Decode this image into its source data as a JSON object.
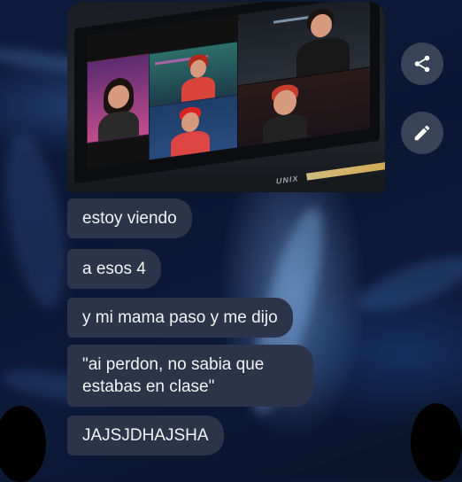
{
  "messages": [
    {
      "text": "estoy viendo"
    },
    {
      "text": "a esos 4"
    },
    {
      "text": "y mi mama paso y me dijo"
    },
    {
      "lines": [
        "\"ai perdon, no sabia que",
        "estabas en clase\""
      ]
    },
    {
      "text": "JAJSJDHAJSHA"
    }
  ],
  "photo": {
    "tv_brand": "UNIX"
  },
  "actions": {
    "share_icon": "share-icon",
    "edit_icon": "pencil-icon"
  },
  "colors": {
    "bubble": "#2c3449",
    "background": "#0b1630",
    "fab": "#3a4459"
  }
}
